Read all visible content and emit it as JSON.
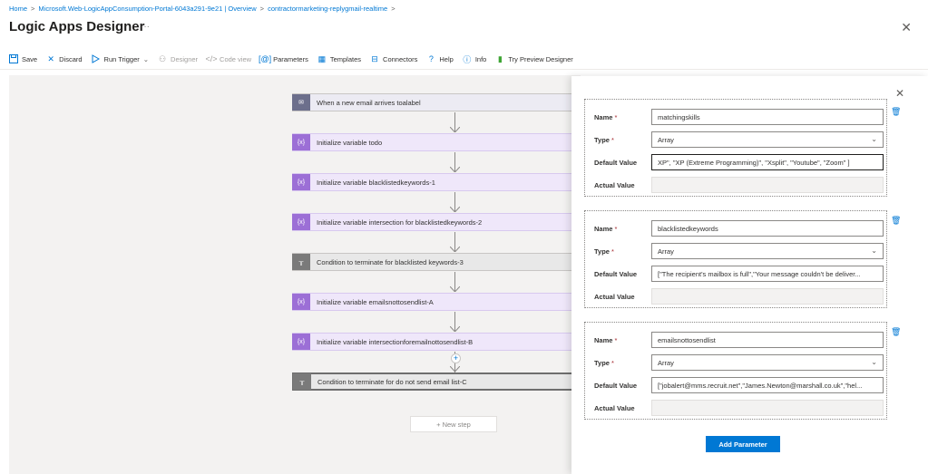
{
  "breadcrumb": {
    "items": [
      "Home",
      "Microsoft.Web-LogicAppConsumption-Portal-6043a291-9e21 | Overview",
      "contractormarketing-replygmail-realtime"
    ]
  },
  "header": {
    "title": "Logic Apps Designer",
    "more": "···",
    "close": "✕"
  },
  "toolbar": {
    "items": [
      {
        "label": "Save",
        "icon": "save-icon"
      },
      {
        "label": "Discard",
        "icon": "close-icon"
      },
      {
        "label": "Run Trigger",
        "icon": "play-icon"
      },
      {
        "label": "Designer",
        "icon": "designer-icon"
      },
      {
        "label": "Code view",
        "icon": "code-icon"
      },
      {
        "label": "Parameters",
        "icon": "parameters-icon"
      },
      {
        "label": "Templates",
        "icon": "templates-icon"
      },
      {
        "label": "Connectors",
        "icon": "connectors-icon"
      },
      {
        "label": "Help",
        "icon": "help-icon"
      },
      {
        "label": "Info",
        "icon": "info-icon"
      },
      {
        "label": "Try Preview Designer",
        "icon": "bookmark-icon"
      }
    ]
  },
  "steps": [
    {
      "label": "When a new email arrives toalabel",
      "kind": "email"
    },
    {
      "label": "Initialize variable todo",
      "kind": "var"
    },
    {
      "label": "Initialize variable blacklistedkeywords-1",
      "kind": "var"
    },
    {
      "label": "Initialize variable intersection for blacklistedkeywords-2",
      "kind": "var"
    },
    {
      "label": "Condition to terminate for blacklisted keywords-3",
      "kind": "cond"
    },
    {
      "label": "Initialize variable emailsnottosendlist-A",
      "kind": "var"
    },
    {
      "label": "Initialize variable intersectionforemailnottosendlist-B",
      "kind": "var"
    },
    {
      "label": "Condition to terminate for do not send email list-C",
      "kind": "cond"
    }
  ],
  "canvas": {
    "new_step": "+ New step",
    "add_plus": "+"
  },
  "panel": {
    "close": "✕",
    "labels": {
      "name": "Name",
      "type": "Type",
      "default_value": "Default Value",
      "actual_value": "Actual Value",
      "required": "*"
    },
    "params": [
      {
        "name": "matchingskills",
        "type": "Array",
        "default_value": "XP\",   \"XP (Extreme Programming)\",   \"Xsplit\",   \"Youtube\",   \"Zoom\" ]",
        "actual_value": ""
      },
      {
        "name": "blacklistedkeywords",
        "type": "Array",
        "default_value": "[\"The recipient's mailbox is full\",\"Your message couldn't be deliver...",
        "actual_value": ""
      },
      {
        "name": "emailsnottosendlist",
        "type": "Array",
        "default_value": "[\"jobalert@mms.recruit.net\",\"James.Newton@marshall.co.uk\",\"hel...",
        "actual_value": ""
      }
    ],
    "add_button": "Add Parameter"
  },
  "colors": {
    "accent": "#0078d4",
    "variable": "#9c6fd6",
    "condition": "#7a7a7a"
  }
}
